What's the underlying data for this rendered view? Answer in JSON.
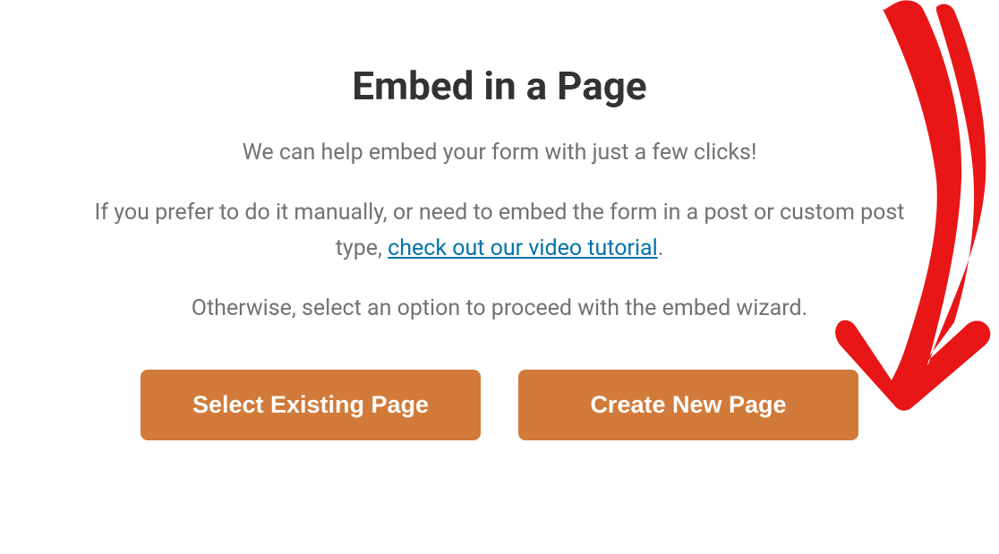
{
  "modal": {
    "title": "Embed in a Page",
    "intro": "We can help embed your form with just a few clicks!",
    "manual_prefix": "If you prefer to do it manually, or need to embed the form in a post or custom post type, ",
    "tutorial_link_text": "check out our video tutorial",
    "manual_suffix": ".",
    "otherwise": "Otherwise, select an option to proceed with the embed wizard.",
    "buttons": {
      "select_existing": "Select Existing Page",
      "create_new": "Create New Page"
    }
  },
  "colors": {
    "button_bg": "#d17a39",
    "link": "#0073aa",
    "text_muted": "#6f7373",
    "title": "#333333",
    "annotation": "#e81616"
  }
}
